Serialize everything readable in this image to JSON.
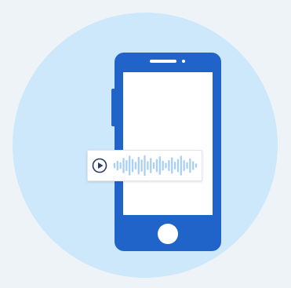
{
  "colors": {
    "background": "#eef3f7",
    "circle": "#cde8fa",
    "phone": "#2064c9",
    "waveform": "#a9d0f2",
    "play": "#2c3a66"
  },
  "icons": {
    "play": "play-circle-icon",
    "phone": "smartphone-icon",
    "waveform": "audio-waveform-icon"
  },
  "waveform_levels": [
    0.25,
    0.45,
    0.3,
    0.7,
    0.5,
    0.9,
    0.6,
    0.35,
    0.8,
    0.55,
    0.95,
    0.4,
    0.7,
    0.3,
    0.6,
    0.85,
    0.45,
    0.25,
    0.5,
    0.75,
    0.35,
    0.6,
    0.9,
    0.5,
    0.3,
    0.65,
    0.4,
    0.2
  ]
}
